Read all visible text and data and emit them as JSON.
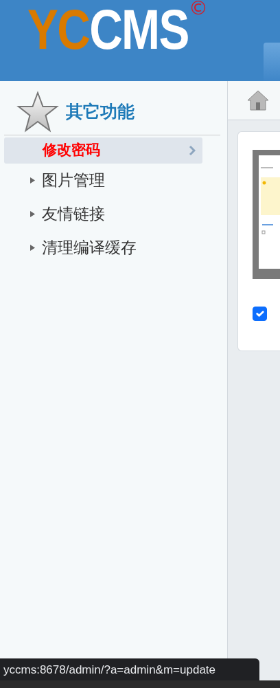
{
  "logo": {
    "parts": [
      {
        "text": "YC",
        "kind": "accent"
      },
      {
        "text": "CMS",
        "kind": "main"
      }
    ],
    "mark": "©"
  },
  "sidebar": {
    "title": "其它功能",
    "items": [
      {
        "label": "修改密码",
        "selected": true
      },
      {
        "label": "图片管理",
        "selected": false
      },
      {
        "label": "友情链接",
        "selected": false
      },
      {
        "label": "清理编译缓存",
        "selected": false
      }
    ]
  },
  "content": {
    "checkbox": {
      "checked": true
    }
  },
  "status_bar": {
    "url": "yccms:8678/admin/?a=admin&m=update"
  }
}
